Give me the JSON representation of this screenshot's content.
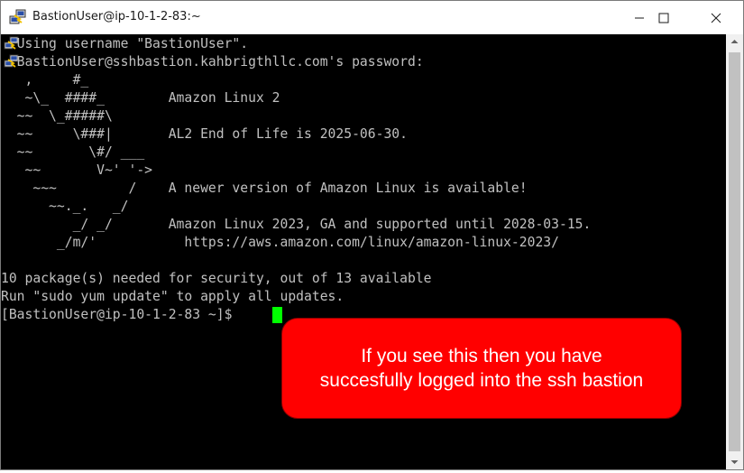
{
  "window": {
    "title": "BastionUser@ip-10-1-2-83:~"
  },
  "icons": {
    "app": "putty-icon",
    "minimize": "minimize-icon",
    "maximize": "maximize-icon",
    "close": "close-icon",
    "line_marker": "putty-icon"
  },
  "terminal": {
    "lines": [
      "  Using username \"BastionUser\".",
      "  BastionUser@sshbastion.kahbrigthllc.com's password:",
      "   ,     #_",
      "   ~\\_  ####_        Amazon Linux 2",
      "  ~~  \\_#####\\",
      "  ~~     \\###|       AL2 End of Life is 2025-06-30.",
      "  ~~       \\#/ ___",
      "   ~~       V~' '->",
      "    ~~~         /    A newer version of Amazon Linux is available!",
      "      ~~._.   _/",
      "         _/ _/       Amazon Linux 2023, GA and supported until 2028-03-15.",
      "       _/m/'           https://aws.amazon.com/linux/amazon-linux-2023/",
      "",
      "10 package(s) needed for security, out of 13 available",
      "Run \"sudo yum update\" to apply all updates.",
      "[BastionUser@ip-10-1-2-83 ~]$ "
    ]
  },
  "callout": {
    "line1": "If you see this then you have",
    "line2": "succesfully logged into the ssh bastion"
  },
  "colors": {
    "terminal_bg": "#000000",
    "terminal_text": "#c0c0c0",
    "cursor": "#00ff00",
    "callout_bg": "#ff0000",
    "callout_text": "#ffffff"
  }
}
